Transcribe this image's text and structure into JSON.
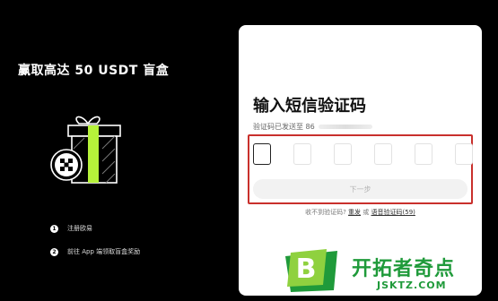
{
  "promo": {
    "title": "赢取高达 50 USDT 盲盒",
    "steps": [
      {
        "num": "1",
        "label": "注册欧易"
      },
      {
        "num": "2",
        "label": "前往 App 端领取盲盒奖励"
      }
    ]
  },
  "verify": {
    "title": "输入短信验证码",
    "subtitle": "验证码已发送至 86",
    "next_label": "下一步",
    "resend_prompt": "收不到验证码?",
    "resend_label": "重发",
    "or": "或",
    "voice_label": "语音验证码(59)",
    "accent_color": "#c9302c"
  },
  "watermark": {
    "text": "开拓者奇点",
    "url": "JSKTZ.COM"
  }
}
